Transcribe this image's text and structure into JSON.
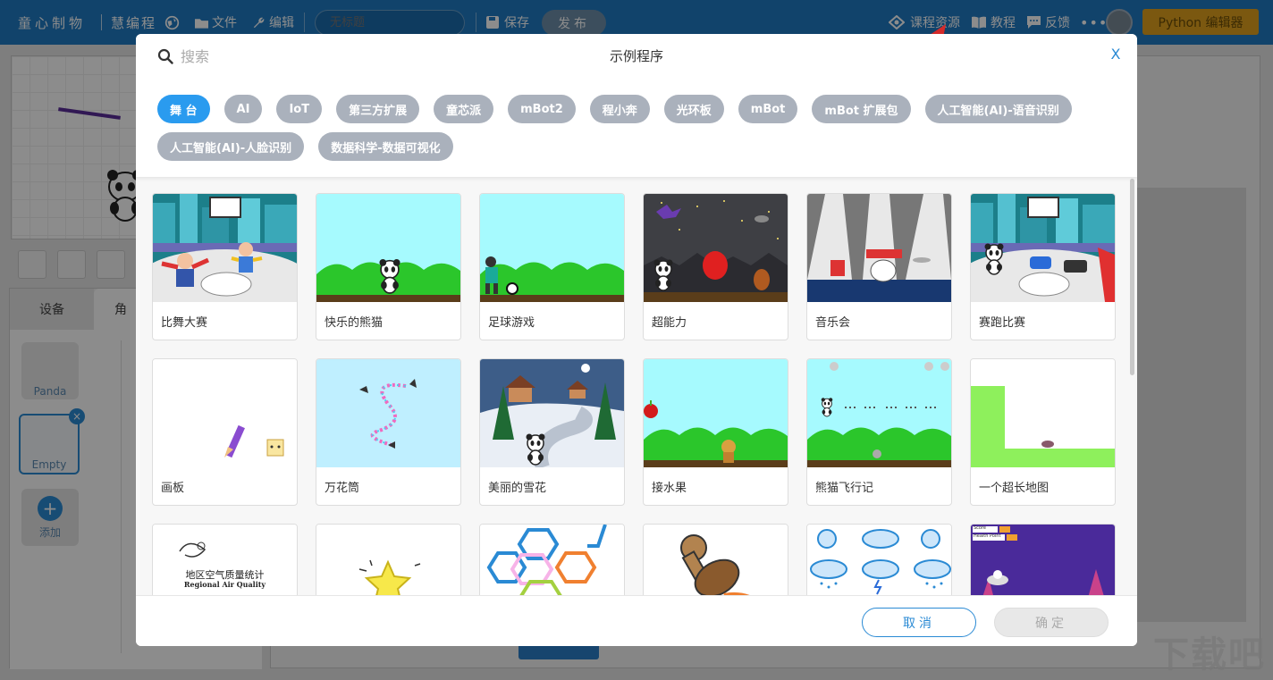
{
  "topbar": {
    "brand": "童心制物",
    "product": "慧编程",
    "file_label": "文件",
    "edit_label": "编辑",
    "title_placeholder": "无标题",
    "save_label": "保存",
    "publish_label": "发布",
    "course_label": "课程资源",
    "tutorial_label": "教程",
    "feedback_label": "反馈",
    "more_label": "•••",
    "python_label": "Python 编辑器"
  },
  "background": {
    "tab_devices": "设备",
    "tab_sprites": "角",
    "sprite_panda": "Panda",
    "sprite_empty": "Empty",
    "add_label": "添加",
    "watermark": "下载吧"
  },
  "modal": {
    "title": "示例程序",
    "search_placeholder": "搜索",
    "close_label": "X",
    "cancel_label": "取消",
    "confirm_label": "确定",
    "tags": [
      {
        "label": "舞 台",
        "active": true
      },
      {
        "label": "AI"
      },
      {
        "label": "IoT"
      },
      {
        "label": "第三方扩展"
      },
      {
        "label": "童芯派"
      },
      {
        "label": "mBot2"
      },
      {
        "label": "程小奔"
      },
      {
        "label": "光环板"
      },
      {
        "label": "mBot"
      },
      {
        "label": "mBot 扩展包"
      },
      {
        "label": "人工智能(AI)-语音识别"
      },
      {
        "label": "人工智能(AI)-人脸识别"
      },
      {
        "label": "数据科学-数据可视化"
      }
    ],
    "cards": [
      {
        "label": "比舞大赛",
        "thumb": "city"
      },
      {
        "label": "快乐的熊猫",
        "thumb": "hills-panda"
      },
      {
        "label": "足球游戏",
        "thumb": "hills-soccer"
      },
      {
        "label": "超能力",
        "thumb": "night"
      },
      {
        "label": "音乐会",
        "thumb": "stage"
      },
      {
        "label": "赛跑比赛",
        "thumb": "city2"
      },
      {
        "label": "画板",
        "thumb": "drawboard"
      },
      {
        "label": "万花筒",
        "thumb": "kaleido"
      },
      {
        "label": "美丽的雪花",
        "thumb": "snow"
      },
      {
        "label": "接水果",
        "thumb": "hills-fruit"
      },
      {
        "label": "熊猫飞行记",
        "thumb": "hills-fly"
      },
      {
        "label": "一个超长地图",
        "thumb": "map"
      },
      {
        "label": "",
        "thumb": "air"
      },
      {
        "label": "",
        "thumb": "star"
      },
      {
        "label": "",
        "thumb": "hex"
      },
      {
        "label": "",
        "thumb": "stamp"
      },
      {
        "label": "",
        "thumb": "weather"
      },
      {
        "label": "",
        "thumb": "space"
      }
    ],
    "air_title": "地区空气质量统计",
    "air_subtitle": "Regional Air Quality",
    "space_score": "Score",
    "space_health": "Health Point"
  },
  "colors": {
    "topbar": "#1f7ac4",
    "accent": "#2a9bef",
    "tag_inactive": "#aab1bc",
    "annotation_arrow": "#d42a2a"
  }
}
